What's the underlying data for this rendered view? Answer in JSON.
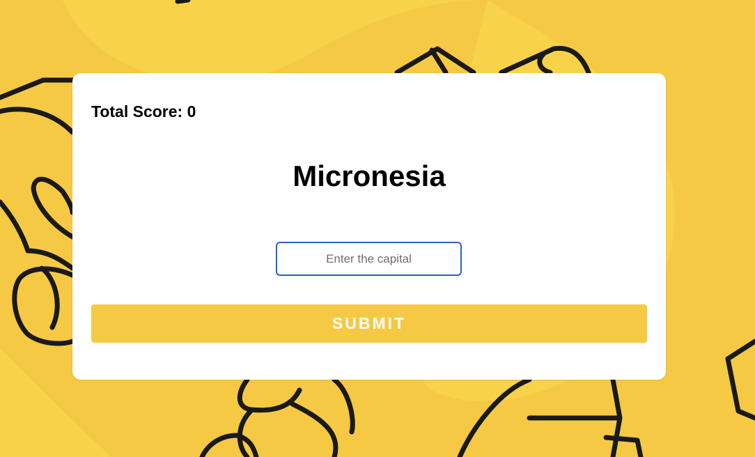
{
  "theme": {
    "background": "#f6c945",
    "accent": "#f6c945",
    "input_border": "#2a62c4"
  },
  "quiz": {
    "score_label": "Total Score: 0",
    "country": "Micronesia",
    "answer_placeholder": "Enter the capital",
    "answer_value": "",
    "submit_label": "SUBMIT"
  }
}
